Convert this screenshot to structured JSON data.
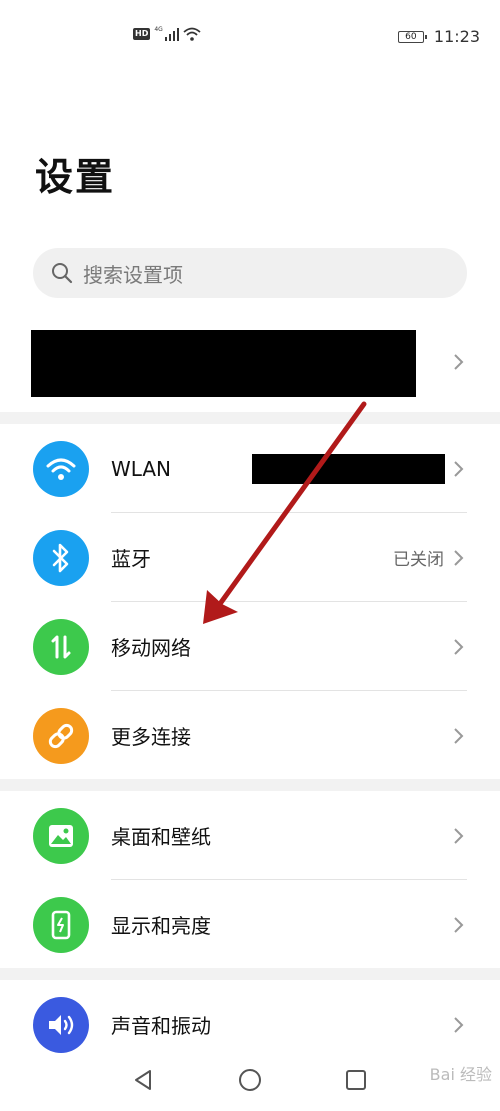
{
  "status_bar": {
    "hd_badge": "HD",
    "network_type": "4G",
    "battery_level": "60",
    "time": "11:23"
  },
  "page": {
    "title": "设置"
  },
  "search": {
    "placeholder": "搜索设置项"
  },
  "connectivity": [
    {
      "label": "WLAN",
      "value": "",
      "icon": "wifi-icon",
      "color": "#1aa1f0"
    },
    {
      "label": "蓝牙",
      "value": "已关闭",
      "icon": "bluetooth-icon",
      "color": "#1aa1f0"
    },
    {
      "label": "移动网络",
      "value": "",
      "icon": "mobile-data-icon",
      "color": "#3dc94c"
    },
    {
      "label": "更多连接",
      "value": "",
      "icon": "link-icon",
      "color": "#f59a1d"
    }
  ],
  "display": [
    {
      "label": "桌面和壁纸",
      "icon": "wallpaper-icon",
      "color": "#3dc94c"
    },
    {
      "label": "显示和亮度",
      "icon": "display-icon",
      "color": "#3dc94c"
    }
  ],
  "sound": [
    {
      "label": "声音和振动",
      "icon": "volume-icon",
      "color": "#3a5ae0"
    }
  ],
  "watermark": "Bai 经验",
  "annotation_color": "#b11a1a"
}
